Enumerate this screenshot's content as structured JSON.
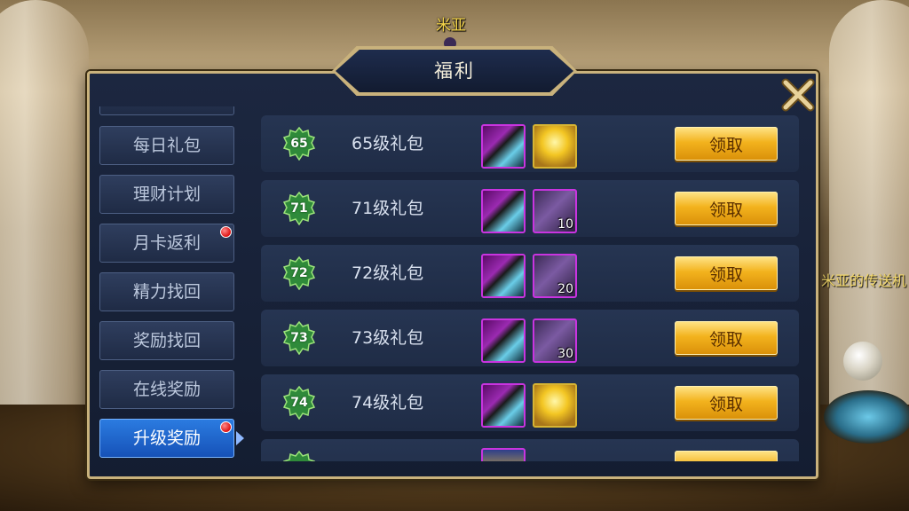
{
  "background": {
    "npc_name": "米亚",
    "portal_text": "米亚的传送机"
  },
  "dialog": {
    "title": "福利",
    "close_icon": "close-x-icon"
  },
  "sidebar": {
    "items": [
      {
        "label": "每日礼包",
        "badge": false,
        "active": false
      },
      {
        "label": "理财计划",
        "badge": false,
        "active": false
      },
      {
        "label": "月卡返利",
        "badge": true,
        "active": false
      },
      {
        "label": "精力找回",
        "badge": false,
        "active": false
      },
      {
        "label": "奖励找回",
        "badge": false,
        "active": false
      },
      {
        "label": "在线奖励",
        "badge": false,
        "active": false
      },
      {
        "label": "升级奖励",
        "badge": true,
        "active": true
      }
    ]
  },
  "rewards": {
    "rows": [
      {
        "level": "65",
        "label": "65级礼包",
        "items": [
          {
            "icon": "weapon-icon",
            "qty": ""
          },
          {
            "icon": "golden-book-icon",
            "qty": ""
          }
        ],
        "button": "领取"
      },
      {
        "level": "71",
        "label": "71级礼包",
        "items": [
          {
            "icon": "weapon-icon",
            "qty": ""
          },
          {
            "icon": "crystal-icon",
            "qty": "10"
          }
        ],
        "button": "领取"
      },
      {
        "level": "72",
        "label": "72级礼包",
        "items": [
          {
            "icon": "weapon-icon",
            "qty": ""
          },
          {
            "icon": "crystal-icon",
            "qty": "20"
          }
        ],
        "button": "领取"
      },
      {
        "level": "73",
        "label": "73级礼包",
        "items": [
          {
            "icon": "weapon-icon",
            "qty": ""
          },
          {
            "icon": "crystal-icon",
            "qty": "30"
          }
        ],
        "button": "领取"
      },
      {
        "level": "74",
        "label": "74级礼包",
        "items": [
          {
            "icon": "weapon-icon",
            "qty": ""
          },
          {
            "icon": "golden-book-icon",
            "qty": ""
          }
        ],
        "button": "领取"
      },
      {
        "level": "",
        "label": "",
        "items": [
          {
            "icon": "shield-icon",
            "qty": ""
          }
        ],
        "button": ""
      }
    ]
  },
  "colors": {
    "accent_gold": "#f3b31e",
    "active_tab": "#2b7be0",
    "panel_bg": "#1c2740",
    "badge_green": "#2f8a3a"
  }
}
